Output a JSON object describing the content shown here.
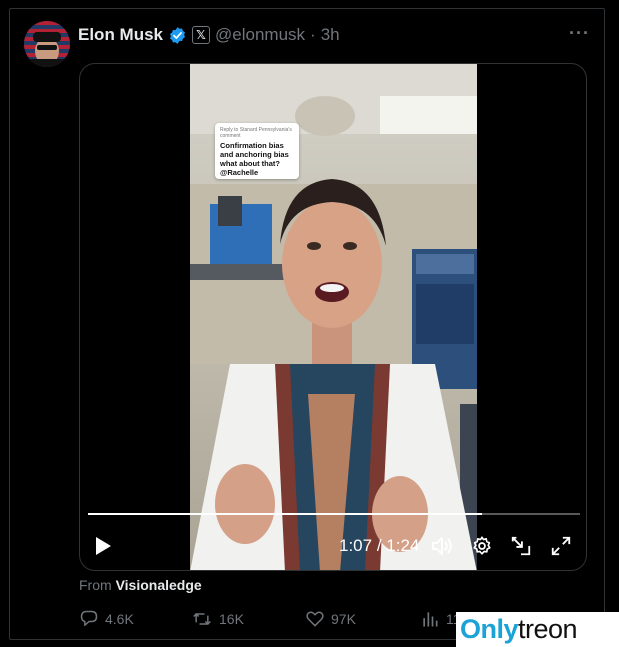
{
  "tweet": {
    "author_name": "Elon Musk",
    "handle": "@elonmusk",
    "separator": "·",
    "time_ago": "3h",
    "more_label": "···",
    "x_badge": "𝕏"
  },
  "video": {
    "caption_reply": "Reply to Stanard Pennsylvania's comment",
    "caption_text": "Confirmation bias and anchoring bias what about that? @Rachelle",
    "progress": 0.8,
    "current_time": "1:07",
    "time_sep": "/",
    "duration": "1:24"
  },
  "source": {
    "prefix": "From",
    "name": "Visionaledge"
  },
  "stats": {
    "replies": "4.6K",
    "reposts": "16K",
    "likes": "97K",
    "views": "11"
  },
  "watermark": {
    "part1": "Only",
    "part2": "treon"
  },
  "colors": {
    "verified": "#1d9bf0",
    "background": "#000000",
    "muted": "#71767b",
    "watermark_blue": "#1ba2d6"
  },
  "icons": {
    "verified": "verified-badge-icon",
    "play": "play-icon",
    "volume": "volume-icon",
    "settings": "gear-icon",
    "pip": "picture-in-picture-icon",
    "fullscreen": "fullscreen-icon",
    "reply": "reply-icon",
    "repost": "repost-icon",
    "like": "heart-icon",
    "views": "views-icon"
  }
}
